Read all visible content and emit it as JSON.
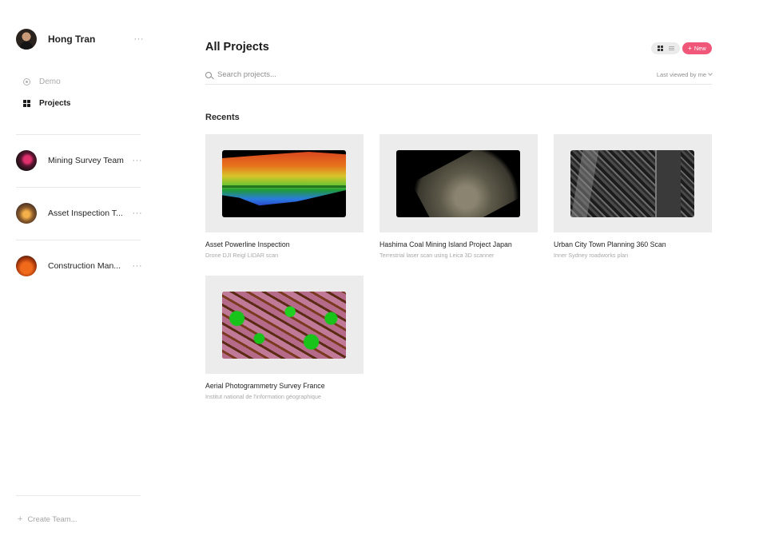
{
  "user": {
    "name": "Hong Tran",
    "more": "···"
  },
  "nav": [
    {
      "label": "Demo",
      "icon": "target-icon"
    },
    {
      "label": "Projects",
      "icon": "grid-icon"
    }
  ],
  "teams": [
    {
      "name": "Mining Survey Team",
      "more": "···"
    },
    {
      "name": "Asset Inspection T...",
      "more": "···"
    },
    {
      "name": "Construction Man...",
      "more": "···"
    }
  ],
  "create_team": {
    "label": "Create Team..."
  },
  "header": {
    "title": "All Projects",
    "new_label": "New"
  },
  "search": {
    "placeholder": "Search projects...",
    "sort_label": "Last viewed by me"
  },
  "recents": {
    "title": "Recents",
    "projects": [
      {
        "title": "Asset Powerline Inspection",
        "subtitle": "Drone DJI Reigl LIDAR scan"
      },
      {
        "title": "Hashima Coal Mining Island Project Japan",
        "subtitle": "Terrestrial laser scan using Leica 3D scanner"
      },
      {
        "title": "Urban City Town Planning 360 Scan",
        "subtitle": "Inner Sydney roadworks plan"
      },
      {
        "title": "Aerial Photogrammetry Survey France",
        "subtitle": "Institut national de l'information géographique"
      }
    ]
  },
  "colors": {
    "accent": "#f0587a",
    "thumb_bg": "#ececec"
  }
}
